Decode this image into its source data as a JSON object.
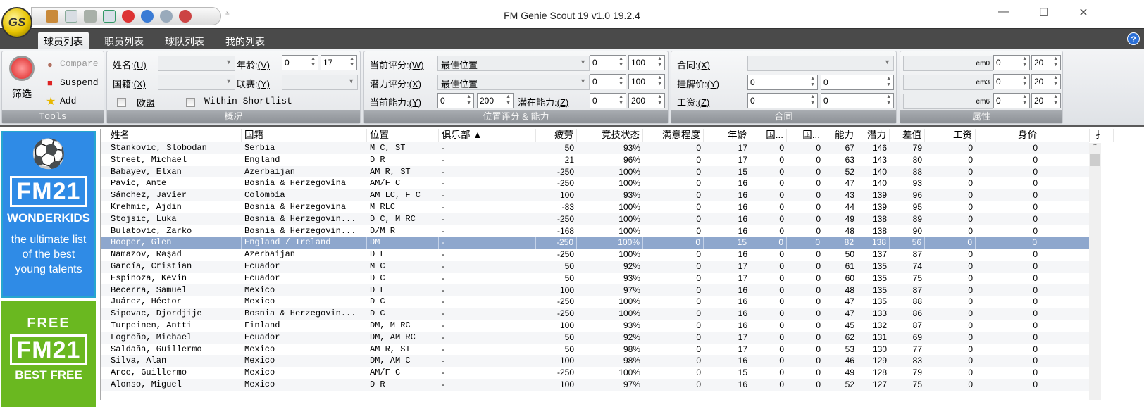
{
  "app": {
    "title": "FM Genie Scout 19 v1.0 19.2.4",
    "logo_text": "GS"
  },
  "quick_access": [
    "new-icon",
    "open-icon",
    "import-icon",
    "save-icon",
    "search-red-icon",
    "search-blue-icon",
    "zoom-icon",
    "search-person-icon"
  ],
  "tabs": [
    "球员列表",
    "职员列表",
    "球队列表",
    "我的列表"
  ],
  "ribbon": {
    "tools": {
      "filter": "筛选",
      "compare": "Compare",
      "suspend": "Suspend",
      "add": "Add",
      "label": "Tools"
    },
    "overview": {
      "name_label": "姓名:",
      "name_key": "(U)",
      "nat_label": "国籍:",
      "nat_key": "(X)",
      "age_label": "年龄:",
      "age_key": "(V)",
      "age_min": "0",
      "age_max": "17",
      "league_label": "联赛:",
      "league_key": "(Y)",
      "eu": "欧盟",
      "shortlist": "Within Shortlist",
      "label": "概况"
    },
    "rating": {
      "cur_label": "当前评分:",
      "cur_key": "(W)",
      "cur_value": "最佳位置",
      "cur_min": "0",
      "cur_max": "100",
      "pot_label": "潜力评分:",
      "pot_key": "(X)",
      "pot_value": "最佳位置",
      "pot_min": "0",
      "pot_max": "100",
      "ca_label": "当前能力:",
      "ca_key": "(Y)",
      "ca_min": "0",
      "ca_max": "200",
      "pa_label": "潜在能力:",
      "pa_key": "(Z)",
      "pa_min": "0",
      "pa_max": "200",
      "label": "位置评分 & 能力"
    },
    "contract": {
      "contract_label": "合同:",
      "contract_key": "(X)",
      "asking_label": "挂牌价:",
      "asking_key": "(Y)",
      "asking_min": "0",
      "asking_max": "0",
      "wage_label": "工资:",
      "wage_key": "(Z)",
      "wage_min": "0",
      "wage_max": "0",
      "label": "合同"
    },
    "attributes": {
      "rows": [
        {
          "tag": "em0",
          "min": "0",
          "max": "20"
        },
        {
          "tag": "em3",
          "min": "0",
          "max": "20"
        },
        {
          "tag": "em6",
          "min": "0",
          "max": "20"
        }
      ],
      "label": "属性"
    }
  },
  "ads": {
    "ad1_title": "WONDERKIDS",
    "ad1_fm": "FM21",
    "ad1_text": "the ultimate list of the best young talents",
    "ad2_top": "FREE",
    "ad2_fm": "FM21",
    "ad2_bottom": "BEST FREE"
  },
  "table": {
    "headers": [
      "姓名",
      "国籍",
      "位置",
      "俱乐部 ▲",
      "疲劳",
      "竞技状态",
      "满意程度",
      "年龄",
      "国...",
      "国...",
      "能力",
      "潜力",
      "差值",
      "工资",
      "身价",
      "",
      "扌"
    ],
    "selected_index": 8,
    "rows": [
      [
        "Stankovic, Slobodan",
        "Serbia",
        "M C, ST",
        "-",
        "50",
        "93%",
        "0",
        "17",
        "0",
        "0",
        "67",
        "146",
        "79",
        "0",
        "0"
      ],
      [
        "Street, Michael",
        "England",
        "D R",
        "-",
        "21",
        "96%",
        "0",
        "17",
        "0",
        "0",
        "63",
        "143",
        "80",
        "0",
        "0"
      ],
      [
        "Babayev, Elxan",
        "Azerbaijan",
        "AM R, ST",
        "-",
        "-250",
        "100%",
        "0",
        "15",
        "0",
        "0",
        "52",
        "140",
        "88",
        "0",
        "0"
      ],
      [
        "Pavic, Ante",
        "Bosnia & Herzegovina",
        "AM/F C",
        "-",
        "-250",
        "100%",
        "0",
        "16",
        "0",
        "0",
        "47",
        "140",
        "93",
        "0",
        "0"
      ],
      [
        "Sánchez, Javier",
        "Colombia",
        "AM LC, F C",
        "-",
        "100",
        "93%",
        "0",
        "16",
        "0",
        "0",
        "43",
        "139",
        "96",
        "0",
        "0"
      ],
      [
        "Krehmic, Ajdin",
        "Bosnia & Herzegovina",
        "M RLC",
        "-",
        "-83",
        "100%",
        "0",
        "16",
        "0",
        "0",
        "44",
        "139",
        "95",
        "0",
        "0"
      ],
      [
        "Stojsic, Luka",
        "Bosnia & Herzegovin...",
        "D C, M RC",
        "-",
        "-250",
        "100%",
        "0",
        "16",
        "0",
        "0",
        "49",
        "138",
        "89",
        "0",
        "0"
      ],
      [
        "Bulatovic, Zarko",
        "Bosnia & Herzegovin...",
        "D/M R",
        "-",
        "-168",
        "100%",
        "0",
        "16",
        "0",
        "0",
        "48",
        "138",
        "90",
        "0",
        "0"
      ],
      [
        "Hooper, Glen",
        "England / Ireland",
        "DM",
        "-",
        "-250",
        "100%",
        "0",
        "15",
        "0",
        "0",
        "82",
        "138",
        "56",
        "0",
        "0"
      ],
      [
        "Namazov, Rəşad",
        "Azerbaijan",
        "D L",
        "-",
        "-250",
        "100%",
        "0",
        "16",
        "0",
        "0",
        "50",
        "137",
        "87",
        "0",
        "0"
      ],
      [
        "García, Cristian",
        "Ecuador",
        "M C",
        "-",
        "50",
        "92%",
        "0",
        "17",
        "0",
        "0",
        "61",
        "135",
        "74",
        "0",
        "0"
      ],
      [
        "Espinoza, Kevin",
        "Ecuador",
        "D C",
        "-",
        "50",
        "93%",
        "0",
        "17",
        "0",
        "0",
        "60",
        "135",
        "75",
        "0",
        "0"
      ],
      [
        "Becerra, Samuel",
        "Mexico",
        "D L",
        "-",
        "100",
        "97%",
        "0",
        "16",
        "0",
        "0",
        "48",
        "135",
        "87",
        "0",
        "0"
      ],
      [
        "Juárez, Héctor",
        "Mexico",
        "D C",
        "-",
        "-250",
        "100%",
        "0",
        "16",
        "0",
        "0",
        "47",
        "135",
        "88",
        "0",
        "0"
      ],
      [
        "Sipovac, Djordjije",
        "Bosnia & Herzegovin...",
        "D C",
        "-",
        "-250",
        "100%",
        "0",
        "16",
        "0",
        "0",
        "47",
        "133",
        "86",
        "0",
        "0"
      ],
      [
        "Turpeinen, Antti",
        "Finland",
        "DM, M RC",
        "-",
        "100",
        "93%",
        "0",
        "16",
        "0",
        "0",
        "45",
        "132",
        "87",
        "0",
        "0"
      ],
      [
        "Logroño, Michael",
        "Ecuador",
        "DM, AM RC",
        "-",
        "50",
        "92%",
        "0",
        "17",
        "0",
        "0",
        "62",
        "131",
        "69",
        "0",
        "0"
      ],
      [
        "Saldaña, Guillermo",
        "Mexico",
        "AM R, ST",
        "-",
        "50",
        "98%",
        "0",
        "17",
        "0",
        "0",
        "53",
        "130",
        "77",
        "0",
        "0"
      ],
      [
        "Silva, Alan",
        "Mexico",
        "DM, AM C",
        "-",
        "100",
        "98%",
        "0",
        "16",
        "0",
        "0",
        "46",
        "129",
        "83",
        "0",
        "0"
      ],
      [
        "Arce, Guillermo",
        "Mexico",
        "AM/F C",
        "-",
        "-250",
        "100%",
        "0",
        "15",
        "0",
        "0",
        "49",
        "128",
        "79",
        "0",
        "0"
      ],
      [
        "Alonso, Miguel",
        "Mexico",
        "D R",
        "-",
        "100",
        "97%",
        "0",
        "16",
        "0",
        "0",
        "52",
        "127",
        "75",
        "0",
        "0"
      ]
    ]
  },
  "colors": {
    "selected_row": "#8ea7cd",
    "tabbar": "#4a4a4a",
    "ad_blue": "#2f8be6",
    "ad_green": "#6ab820"
  }
}
